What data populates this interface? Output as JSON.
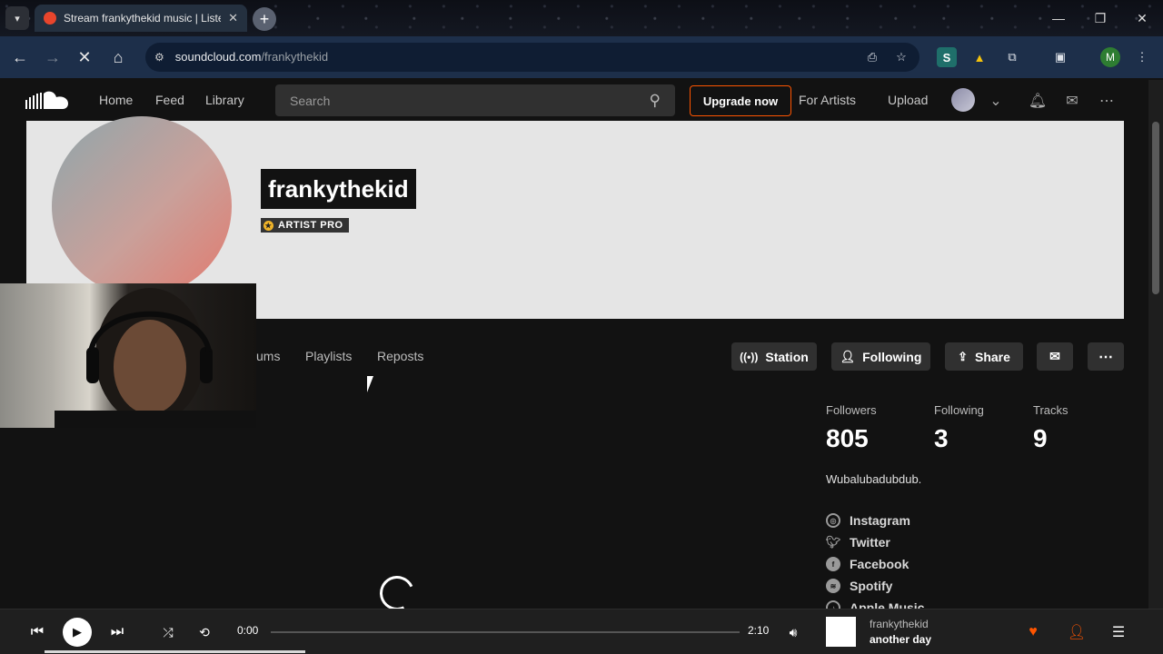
{
  "browser": {
    "tab_title": "Stream frankythekid music | Listen",
    "tab_close": "✕",
    "url_host": "soundcloud.com",
    "url_path": "/frankythekid",
    "profile_initial": "M"
  },
  "header": {
    "nav": [
      "Home",
      "Feed",
      "Library"
    ],
    "search_placeholder": "Search",
    "upgrade_label": "Upgrade now",
    "for_artists_label": "For Artists",
    "upload_label": "Upload"
  },
  "profile": {
    "username": "frankythekid",
    "badge": "ARTIST PRO",
    "tabs": [
      "ums",
      "Playlists",
      "Reposts"
    ],
    "actions": {
      "station": "Station",
      "following": "Following",
      "share": "Share"
    },
    "stats": [
      {
        "label": "Followers",
        "value": "805"
      },
      {
        "label": "Following",
        "value": "3"
      },
      {
        "label": "Tracks",
        "value": "9"
      }
    ],
    "bio": "Wubalubadubdub.",
    "links": [
      "Instagram",
      "Twitter",
      "Facebook",
      "Spotify",
      "Apple Music"
    ]
  },
  "player": {
    "elapsed": "0:00",
    "duration": "2:10",
    "progress": 0,
    "track_artist": "frankythekid",
    "track_title": "another day"
  },
  "colors": {
    "accent": "#ff5500",
    "banner": "#e5e5e5",
    "background": "#121212"
  }
}
